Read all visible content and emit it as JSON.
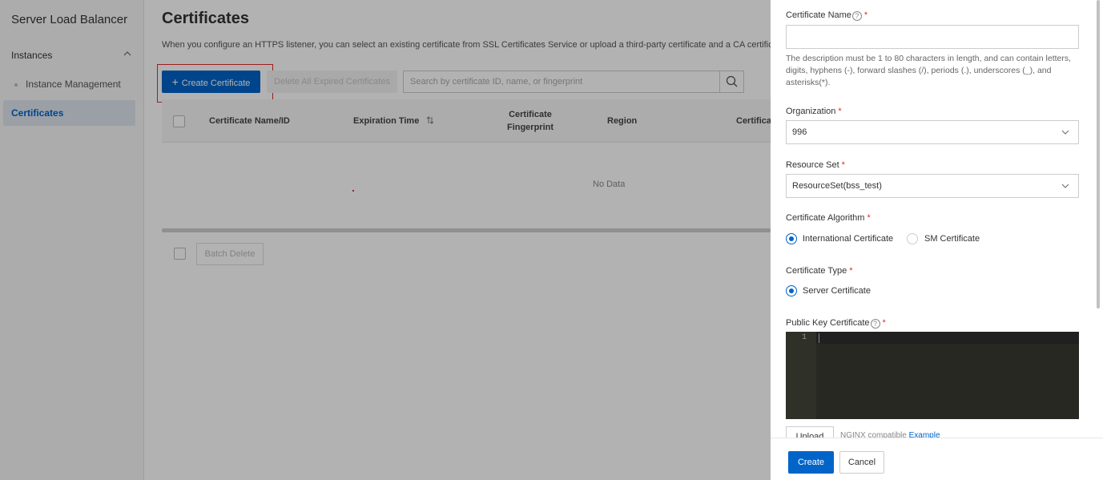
{
  "sidebar": {
    "title": "Server Load Balancer",
    "group_label": "Instances",
    "sub_item": "Instance Management",
    "active_item": "Certificates"
  },
  "main": {
    "title": "Certificates",
    "description": "When you configure an HTTPS listener, you can select an existing certificate from SSL Certificates Service or upload a third-party certificate and a CA certificate t",
    "create_button": "Create Certificate",
    "delete_expired_button": "Delete All Expired Certificates",
    "search_placeholder": "Search by certificate ID, name, or fingerprint",
    "columns": {
      "name": "Certificate Name/ID",
      "expiration": "Expiration Time",
      "fingerprint": "Certificate Fingerprint",
      "region": "Region",
      "partial": "Certificat"
    },
    "empty_text": "No Data",
    "batch_delete_button": "Batch Delete"
  },
  "drawer": {
    "cert_name_label": "Certificate Name",
    "cert_name_value": "",
    "cert_name_help": "The description must be 1 to 80 characters in length, and can contain letters, digits, hyphens (-), forward slashes (/), periods (.), underscores (_), and asterisks(*).",
    "org_label": "Organization",
    "org_value": "996",
    "resource_set_label": "Resource Set",
    "resource_set_value": "ResourceSet(bss_test)",
    "algo_label": "Certificate Algorithm",
    "algo_options": [
      "International Certificate",
      "SM Certificate"
    ],
    "algo_selected": "International Certificate",
    "type_label": "Certificate Type",
    "type_options": [
      "Server Certificate"
    ],
    "public_key_label": "Public Key Certificate",
    "editor_line": "1",
    "upload_button": "Upload",
    "upload_hint": "NGINX compatible",
    "upload_link": "Example",
    "create_button": "Create",
    "cancel_button": "Cancel"
  },
  "colors": {
    "primary": "#0064c8",
    "required": "#e12b2b",
    "highlight": "#e12b2b",
    "editor_bg": "#272822"
  }
}
